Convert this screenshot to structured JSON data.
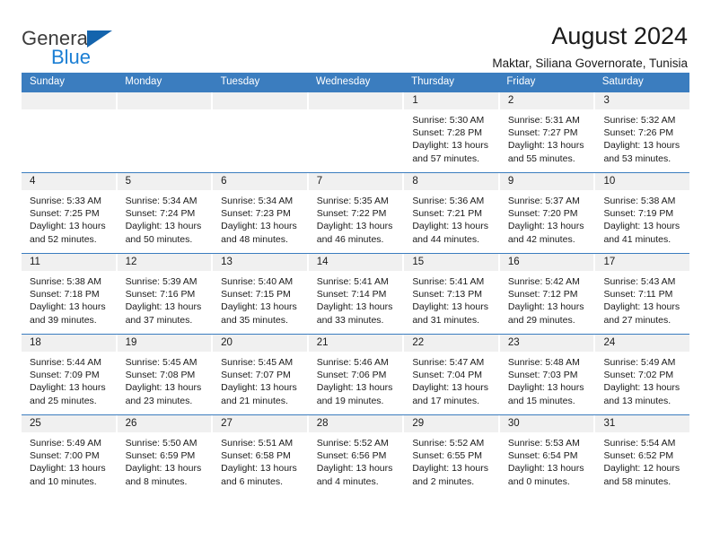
{
  "brand": {
    "name_part1": "General",
    "name_part2": "Blue",
    "logo_icon": "triangle-logo-icon"
  },
  "header": {
    "title": "August 2024",
    "subtitle": "Maktar, Siliana Governorate, Tunisia"
  },
  "colors": {
    "header_blue": "#3b7dbf",
    "brand_blue": "#1b7fd4",
    "logo_blue": "#1464ad",
    "day_band": "#f0f0f0",
    "text": "#1a1a1a"
  },
  "weekdays": [
    "Sunday",
    "Monday",
    "Tuesday",
    "Wednesday",
    "Thursday",
    "Friday",
    "Saturday"
  ],
  "weeks": [
    [
      {
        "day": "",
        "empty": true,
        "sunrise": "",
        "sunset": "",
        "daylight_line1": "",
        "daylight_line2": ""
      },
      {
        "day": "",
        "empty": true,
        "sunrise": "",
        "sunset": "",
        "daylight_line1": "",
        "daylight_line2": ""
      },
      {
        "day": "",
        "empty": true,
        "sunrise": "",
        "sunset": "",
        "daylight_line1": "",
        "daylight_line2": ""
      },
      {
        "day": "",
        "empty": true,
        "sunrise": "",
        "sunset": "",
        "daylight_line1": "",
        "daylight_line2": ""
      },
      {
        "day": "1",
        "empty": false,
        "sunrise": "Sunrise: 5:30 AM",
        "sunset": "Sunset: 7:28 PM",
        "daylight_line1": "Daylight: 13 hours",
        "daylight_line2": "and 57 minutes."
      },
      {
        "day": "2",
        "empty": false,
        "sunrise": "Sunrise: 5:31 AM",
        "sunset": "Sunset: 7:27 PM",
        "daylight_line1": "Daylight: 13 hours",
        "daylight_line2": "and 55 minutes."
      },
      {
        "day": "3",
        "empty": false,
        "sunrise": "Sunrise: 5:32 AM",
        "sunset": "Sunset: 7:26 PM",
        "daylight_line1": "Daylight: 13 hours",
        "daylight_line2": "and 53 minutes."
      }
    ],
    [
      {
        "day": "4",
        "empty": false,
        "sunrise": "Sunrise: 5:33 AM",
        "sunset": "Sunset: 7:25 PM",
        "daylight_line1": "Daylight: 13 hours",
        "daylight_line2": "and 52 minutes."
      },
      {
        "day": "5",
        "empty": false,
        "sunrise": "Sunrise: 5:34 AM",
        "sunset": "Sunset: 7:24 PM",
        "daylight_line1": "Daylight: 13 hours",
        "daylight_line2": "and 50 minutes."
      },
      {
        "day": "6",
        "empty": false,
        "sunrise": "Sunrise: 5:34 AM",
        "sunset": "Sunset: 7:23 PM",
        "daylight_line1": "Daylight: 13 hours",
        "daylight_line2": "and 48 minutes."
      },
      {
        "day": "7",
        "empty": false,
        "sunrise": "Sunrise: 5:35 AM",
        "sunset": "Sunset: 7:22 PM",
        "daylight_line1": "Daylight: 13 hours",
        "daylight_line2": "and 46 minutes."
      },
      {
        "day": "8",
        "empty": false,
        "sunrise": "Sunrise: 5:36 AM",
        "sunset": "Sunset: 7:21 PM",
        "daylight_line1": "Daylight: 13 hours",
        "daylight_line2": "and 44 minutes."
      },
      {
        "day": "9",
        "empty": false,
        "sunrise": "Sunrise: 5:37 AM",
        "sunset": "Sunset: 7:20 PM",
        "daylight_line1": "Daylight: 13 hours",
        "daylight_line2": "and 42 minutes."
      },
      {
        "day": "10",
        "empty": false,
        "sunrise": "Sunrise: 5:38 AM",
        "sunset": "Sunset: 7:19 PM",
        "daylight_line1": "Daylight: 13 hours",
        "daylight_line2": "and 41 minutes."
      }
    ],
    [
      {
        "day": "11",
        "empty": false,
        "sunrise": "Sunrise: 5:38 AM",
        "sunset": "Sunset: 7:18 PM",
        "daylight_line1": "Daylight: 13 hours",
        "daylight_line2": "and 39 minutes."
      },
      {
        "day": "12",
        "empty": false,
        "sunrise": "Sunrise: 5:39 AM",
        "sunset": "Sunset: 7:16 PM",
        "daylight_line1": "Daylight: 13 hours",
        "daylight_line2": "and 37 minutes."
      },
      {
        "day": "13",
        "empty": false,
        "sunrise": "Sunrise: 5:40 AM",
        "sunset": "Sunset: 7:15 PM",
        "daylight_line1": "Daylight: 13 hours",
        "daylight_line2": "and 35 minutes."
      },
      {
        "day": "14",
        "empty": false,
        "sunrise": "Sunrise: 5:41 AM",
        "sunset": "Sunset: 7:14 PM",
        "daylight_line1": "Daylight: 13 hours",
        "daylight_line2": "and 33 minutes."
      },
      {
        "day": "15",
        "empty": false,
        "sunrise": "Sunrise: 5:41 AM",
        "sunset": "Sunset: 7:13 PM",
        "daylight_line1": "Daylight: 13 hours",
        "daylight_line2": "and 31 minutes."
      },
      {
        "day": "16",
        "empty": false,
        "sunrise": "Sunrise: 5:42 AM",
        "sunset": "Sunset: 7:12 PM",
        "daylight_line1": "Daylight: 13 hours",
        "daylight_line2": "and 29 minutes."
      },
      {
        "day": "17",
        "empty": false,
        "sunrise": "Sunrise: 5:43 AM",
        "sunset": "Sunset: 7:11 PM",
        "daylight_line1": "Daylight: 13 hours",
        "daylight_line2": "and 27 minutes."
      }
    ],
    [
      {
        "day": "18",
        "empty": false,
        "sunrise": "Sunrise: 5:44 AM",
        "sunset": "Sunset: 7:09 PM",
        "daylight_line1": "Daylight: 13 hours",
        "daylight_line2": "and 25 minutes."
      },
      {
        "day": "19",
        "empty": false,
        "sunrise": "Sunrise: 5:45 AM",
        "sunset": "Sunset: 7:08 PM",
        "daylight_line1": "Daylight: 13 hours",
        "daylight_line2": "and 23 minutes."
      },
      {
        "day": "20",
        "empty": false,
        "sunrise": "Sunrise: 5:45 AM",
        "sunset": "Sunset: 7:07 PM",
        "daylight_line1": "Daylight: 13 hours",
        "daylight_line2": "and 21 minutes."
      },
      {
        "day": "21",
        "empty": false,
        "sunrise": "Sunrise: 5:46 AM",
        "sunset": "Sunset: 7:06 PM",
        "daylight_line1": "Daylight: 13 hours",
        "daylight_line2": "and 19 minutes."
      },
      {
        "day": "22",
        "empty": false,
        "sunrise": "Sunrise: 5:47 AM",
        "sunset": "Sunset: 7:04 PM",
        "daylight_line1": "Daylight: 13 hours",
        "daylight_line2": "and 17 minutes."
      },
      {
        "day": "23",
        "empty": false,
        "sunrise": "Sunrise: 5:48 AM",
        "sunset": "Sunset: 7:03 PM",
        "daylight_line1": "Daylight: 13 hours",
        "daylight_line2": "and 15 minutes."
      },
      {
        "day": "24",
        "empty": false,
        "sunrise": "Sunrise: 5:49 AM",
        "sunset": "Sunset: 7:02 PM",
        "daylight_line1": "Daylight: 13 hours",
        "daylight_line2": "and 13 minutes."
      }
    ],
    [
      {
        "day": "25",
        "empty": false,
        "sunrise": "Sunrise: 5:49 AM",
        "sunset": "Sunset: 7:00 PM",
        "daylight_line1": "Daylight: 13 hours",
        "daylight_line2": "and 10 minutes."
      },
      {
        "day": "26",
        "empty": false,
        "sunrise": "Sunrise: 5:50 AM",
        "sunset": "Sunset: 6:59 PM",
        "daylight_line1": "Daylight: 13 hours",
        "daylight_line2": "and 8 minutes."
      },
      {
        "day": "27",
        "empty": false,
        "sunrise": "Sunrise: 5:51 AM",
        "sunset": "Sunset: 6:58 PM",
        "daylight_line1": "Daylight: 13 hours",
        "daylight_line2": "and 6 minutes."
      },
      {
        "day": "28",
        "empty": false,
        "sunrise": "Sunrise: 5:52 AM",
        "sunset": "Sunset: 6:56 PM",
        "daylight_line1": "Daylight: 13 hours",
        "daylight_line2": "and 4 minutes."
      },
      {
        "day": "29",
        "empty": false,
        "sunrise": "Sunrise: 5:52 AM",
        "sunset": "Sunset: 6:55 PM",
        "daylight_line1": "Daylight: 13 hours",
        "daylight_line2": "and 2 minutes."
      },
      {
        "day": "30",
        "empty": false,
        "sunrise": "Sunrise: 5:53 AM",
        "sunset": "Sunset: 6:54 PM",
        "daylight_line1": "Daylight: 13 hours",
        "daylight_line2": "and 0 minutes."
      },
      {
        "day": "31",
        "empty": false,
        "sunrise": "Sunrise: 5:54 AM",
        "sunset": "Sunset: 6:52 PM",
        "daylight_line1": "Daylight: 12 hours",
        "daylight_line2": "and 58 minutes."
      }
    ]
  ]
}
